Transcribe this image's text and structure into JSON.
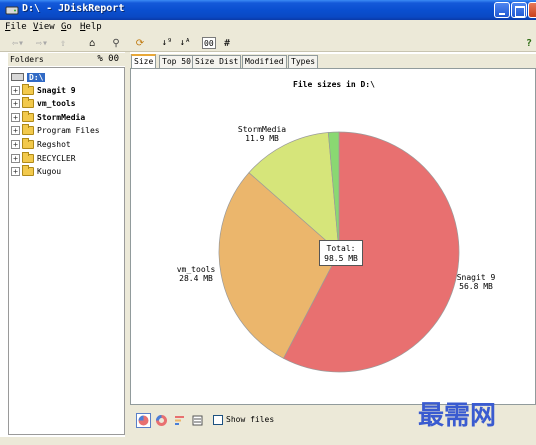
{
  "window": {
    "title": "D:\\ - JDiskReport",
    "app_icon": "jdiskreport-icon"
  },
  "menu": [
    "File",
    "View",
    "Go",
    "Help"
  ],
  "toolbar": {
    "buttons": [
      "back-icon",
      "forward-icon",
      "up-icon",
      "home-icon",
      "search-icon",
      "refresh-icon",
      "sort-desc-icon",
      "sort-asc-icon"
    ],
    "number_format": "00",
    "hash": "#",
    "help": "?"
  },
  "folders_panel": {
    "header": "Folders",
    "percent_label": "% 00",
    "root": "D:\\",
    "items": [
      {
        "label": "Snagit 9",
        "bold": true
      },
      {
        "label": "vm_tools",
        "bold": true
      },
      {
        "label": "StormMedia",
        "bold": true
      },
      {
        "label": "Program Files",
        "bold": false
      },
      {
        "label": "Regshot",
        "bold": false
      },
      {
        "label": "RECYCLER",
        "bold": false
      },
      {
        "label": "Kugou",
        "bold": false
      }
    ]
  },
  "tabs": [
    "Size",
    "Top 50",
    "Size Dist",
    "Modified",
    "Types"
  ],
  "active_tab": "Size",
  "chart_data": {
    "type": "pie",
    "title": "File sizes in D:\\",
    "slices": [
      {
        "name": "Snagit 9",
        "value": 56.8,
        "label": "56.8 MB",
        "color": "#e87070"
      },
      {
        "name": "vm_tools",
        "value": 28.4,
        "label": "28.4 MB",
        "color": "#ebb66c"
      },
      {
        "name": "StormMedia",
        "value": 11.9,
        "label": "11.9 MB",
        "color": "#d6e57a"
      },
      {
        "name": "",
        "value": 1.4,
        "label": "",
        "color": "#8ad872"
      }
    ],
    "total_label": "Total:",
    "total_value": "98.5 MB"
  },
  "bottom": {
    "view_buttons": [
      "pie-chart-icon",
      "ring-chart-icon",
      "bar-chart-icon",
      "list-view-icon"
    ],
    "show_files_label": "Show files",
    "show_files_checked": false
  },
  "watermark": "最需网"
}
